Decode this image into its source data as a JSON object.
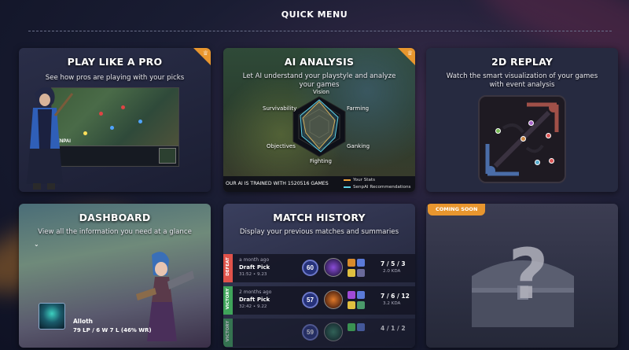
{
  "page": {
    "title": "QUICK MENU"
  },
  "cards": {
    "play_like_pro": {
      "title": "PLAY LIKE A PRO",
      "subtitle": "See how pros are playing with your picks",
      "badge_icon": "crown-icon",
      "game_tag": "SENPAI"
    },
    "ai_analysis": {
      "title": "AI ANALYSIS",
      "subtitle": "Let AI understand your playstyle and analyze your games",
      "badge_icon": "crown-icon",
      "radar_labels": {
        "vision": "Vision",
        "farming": "Farming",
        "ganking": "Ganking",
        "fighting": "Fighting",
        "objectives": "Objectives",
        "survivability": "Survivability"
      },
      "footer_text": "OUR AI IS TRAINED WITH 1520516 GAMES",
      "legend": [
        {
          "label": "Your Stats",
          "color": "#f0a43a"
        },
        {
          "label": "SenpAI Recommendations",
          "color": "#5fd3e8"
        }
      ]
    },
    "replay_2d": {
      "title": "2D REPLAY",
      "subtitle": "Watch the smart visualization of your games with event analysis"
    },
    "dashboard": {
      "title": "DASHBOARD",
      "subtitle": "View all the information you need at a glance",
      "profile": {
        "name": "Alloth",
        "stats": "79 LP / 6 W 7 L (46% WR)"
      }
    },
    "match_history": {
      "title": "MATCH HISTORY",
      "subtitle": "Display your previous matches and summaries",
      "matches": [
        {
          "result": "DEFEAT",
          "color": "#e0524a",
          "time_ago": "a month ago",
          "mode": "Draft Pick",
          "duration": "31:52 • 9.23",
          "score": "60",
          "kda": "7 / 5 / 3",
          "kda_ratio": "2.0 KDA"
        },
        {
          "result": "VICTORY",
          "color": "#3fa45a",
          "time_ago": "2 months ago",
          "mode": "Draft Pick",
          "duration": "32:42 • 9.22",
          "score": "57",
          "kda": "7 / 6 / 12",
          "kda_ratio": "3.2 KDA"
        },
        {
          "result": "VICTORY",
          "color": "#3fa45a",
          "time_ago": "",
          "mode": "",
          "duration": "",
          "score": "59",
          "kda": "4 / 1 / 2",
          "kda_ratio": ""
        }
      ]
    },
    "coming_soon": {
      "badge": "COMING SOON"
    }
  },
  "colors": {
    "accent_orange": "#e8962e",
    "card_bg": "#20243d",
    "page_bg": "#161a2e"
  }
}
